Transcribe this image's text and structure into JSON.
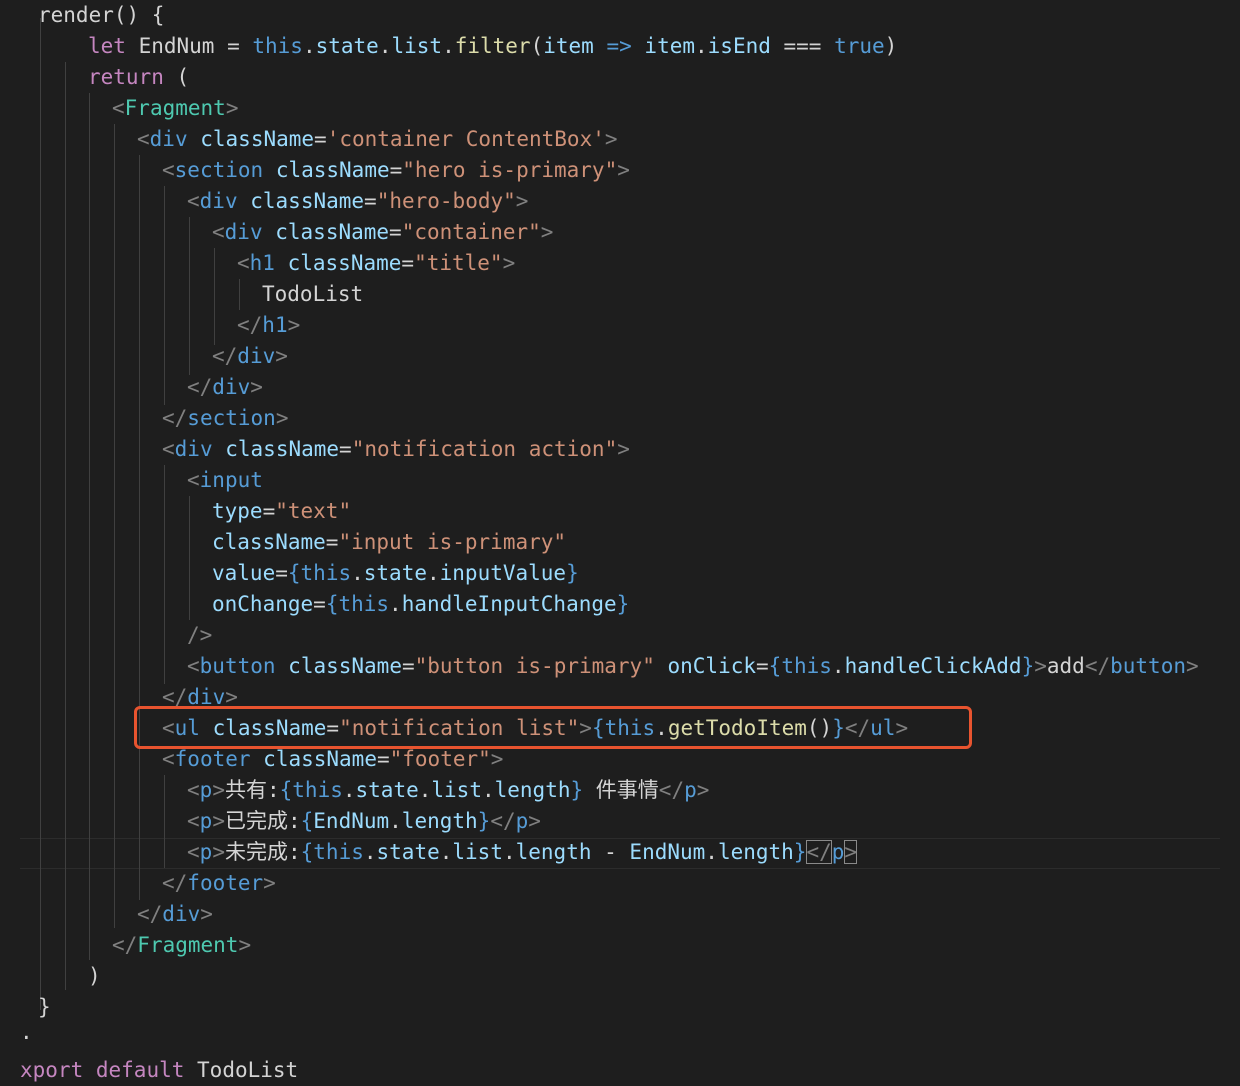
{
  "editor": {
    "theme": "dark",
    "highlight_color": "#e8542f",
    "lines": [
      [
        [
          "plain",
          "render() {"
        ]
      ],
      [
        [
          "kw",
          "let"
        ],
        [
          "plain",
          " EndNum = "
        ],
        [
          "var",
          "this"
        ],
        [
          "plain",
          "."
        ],
        [
          "prop",
          "state"
        ],
        [
          "plain",
          "."
        ],
        [
          "prop",
          "list"
        ],
        [
          "plain",
          "."
        ],
        [
          "fn",
          "filter"
        ],
        [
          "plain",
          "("
        ],
        [
          "prop",
          "item"
        ],
        [
          "plain",
          " "
        ],
        [
          "var",
          "=>"
        ],
        [
          "plain",
          " "
        ],
        [
          "prop",
          "item"
        ],
        [
          "plain",
          "."
        ],
        [
          "prop",
          "isEnd"
        ],
        [
          "plain",
          " === "
        ],
        [
          "var",
          "true"
        ],
        [
          "plain",
          ")"
        ]
      ],
      [
        [
          "kw",
          "return"
        ],
        [
          "plain",
          " ("
        ]
      ],
      [
        [
          "punct",
          "<"
        ],
        [
          "comp",
          "Fragment"
        ],
        [
          "punct",
          ">"
        ]
      ],
      [
        [
          "punct",
          "<"
        ],
        [
          "tag",
          "div"
        ],
        [
          "plain",
          " "
        ],
        [
          "attr",
          "className"
        ],
        [
          "plain",
          "="
        ],
        [
          "str",
          "'container ContentBox'"
        ],
        [
          "punct",
          ">"
        ]
      ],
      [
        [
          "punct",
          "<"
        ],
        [
          "tag",
          "section"
        ],
        [
          "plain",
          " "
        ],
        [
          "attr",
          "className"
        ],
        [
          "plain",
          "="
        ],
        [
          "str",
          "\"hero is-primary\""
        ],
        [
          "punct",
          ">"
        ]
      ],
      [
        [
          "punct",
          "<"
        ],
        [
          "tag",
          "div"
        ],
        [
          "plain",
          " "
        ],
        [
          "attr",
          "className"
        ],
        [
          "plain",
          "="
        ],
        [
          "str",
          "\"hero-body\""
        ],
        [
          "punct",
          ">"
        ]
      ],
      [
        [
          "punct",
          "<"
        ],
        [
          "tag",
          "div"
        ],
        [
          "plain",
          " "
        ],
        [
          "attr",
          "className"
        ],
        [
          "plain",
          "="
        ],
        [
          "str",
          "\"container\""
        ],
        [
          "punct",
          ">"
        ]
      ],
      [
        [
          "punct",
          "<"
        ],
        [
          "tag",
          "h1"
        ],
        [
          "plain",
          " "
        ],
        [
          "attr",
          "className"
        ],
        [
          "plain",
          "="
        ],
        [
          "str",
          "\"title\""
        ],
        [
          "punct",
          ">"
        ]
      ],
      [
        [
          "plain",
          "TodoList"
        ]
      ],
      [
        [
          "punct",
          "</"
        ],
        [
          "tag",
          "h1"
        ],
        [
          "punct",
          ">"
        ]
      ],
      [
        [
          "punct",
          "</"
        ],
        [
          "tag",
          "div"
        ],
        [
          "punct",
          ">"
        ]
      ],
      [
        [
          "punct",
          "</"
        ],
        [
          "tag",
          "div"
        ],
        [
          "punct",
          ">"
        ]
      ],
      [
        [
          "punct",
          "</"
        ],
        [
          "tag",
          "section"
        ],
        [
          "punct",
          ">"
        ]
      ],
      [
        [
          "punct",
          "<"
        ],
        [
          "tag",
          "div"
        ],
        [
          "plain",
          " "
        ],
        [
          "attr",
          "className"
        ],
        [
          "plain",
          "="
        ],
        [
          "str",
          "\"notification action\""
        ],
        [
          "punct",
          ">"
        ]
      ],
      [
        [
          "punct",
          "<"
        ],
        [
          "tag",
          "input"
        ]
      ],
      [
        [
          "attr",
          "type"
        ],
        [
          "plain",
          "="
        ],
        [
          "str",
          "\"text\""
        ]
      ],
      [
        [
          "attr",
          "className"
        ],
        [
          "plain",
          "="
        ],
        [
          "str",
          "\"input is-primary\""
        ]
      ],
      [
        [
          "attr",
          "value"
        ],
        [
          "plain",
          "="
        ],
        [
          "brace",
          "{"
        ],
        [
          "var",
          "this"
        ],
        [
          "plain",
          "."
        ],
        [
          "prop",
          "state"
        ],
        [
          "plain",
          "."
        ],
        [
          "prop",
          "inputValue"
        ],
        [
          "brace",
          "}"
        ]
      ],
      [
        [
          "attr",
          "onChange"
        ],
        [
          "plain",
          "="
        ],
        [
          "brace",
          "{"
        ],
        [
          "var",
          "this"
        ],
        [
          "plain",
          "."
        ],
        [
          "prop",
          "handleInputChange"
        ],
        [
          "brace",
          "}"
        ]
      ],
      [
        [
          "punct",
          "/>"
        ]
      ],
      [
        [
          "punct",
          "<"
        ],
        [
          "tag",
          "button"
        ],
        [
          "plain",
          " "
        ],
        [
          "attr",
          "className"
        ],
        [
          "plain",
          "="
        ],
        [
          "str",
          "\"button is-primary\""
        ],
        [
          "plain",
          " "
        ],
        [
          "attr",
          "onClick"
        ],
        [
          "plain",
          "="
        ],
        [
          "brace",
          "{"
        ],
        [
          "var",
          "this"
        ],
        [
          "plain",
          "."
        ],
        [
          "prop",
          "handleClickAdd"
        ],
        [
          "brace",
          "}"
        ],
        [
          "punct",
          ">"
        ],
        [
          "plain",
          "add"
        ],
        [
          "punct",
          "</"
        ],
        [
          "tag",
          "button"
        ],
        [
          "punct",
          ">"
        ]
      ],
      [
        [
          "punct",
          "</"
        ],
        [
          "tag",
          "div"
        ],
        [
          "punct",
          ">"
        ]
      ],
      [
        [
          "punct",
          "<"
        ],
        [
          "tag",
          "ul"
        ],
        [
          "plain",
          " "
        ],
        [
          "attr",
          "className"
        ],
        [
          "plain",
          "="
        ],
        [
          "str",
          "\"notification list\""
        ],
        [
          "punct",
          ">"
        ],
        [
          "brace",
          "{"
        ],
        [
          "var",
          "this"
        ],
        [
          "plain",
          "."
        ],
        [
          "fn",
          "getTodoItem"
        ],
        [
          "plain",
          "()"
        ],
        [
          "brace",
          "}"
        ],
        [
          "punct",
          "</"
        ],
        [
          "tag",
          "ul"
        ],
        [
          "punct",
          ">"
        ]
      ],
      [
        [
          "punct",
          "<"
        ],
        [
          "tag",
          "footer"
        ],
        [
          "plain",
          " "
        ],
        [
          "attr",
          "className"
        ],
        [
          "plain",
          "="
        ],
        [
          "str",
          "\"footer\""
        ],
        [
          "punct",
          ">"
        ]
      ],
      [
        [
          "punct",
          "<"
        ],
        [
          "tag",
          "p"
        ],
        [
          "punct",
          ">"
        ],
        [
          "plain",
          "共有:"
        ],
        [
          "brace",
          "{"
        ],
        [
          "var",
          "this"
        ],
        [
          "plain",
          "."
        ],
        [
          "prop",
          "state"
        ],
        [
          "plain",
          "."
        ],
        [
          "prop",
          "list"
        ],
        [
          "plain",
          "."
        ],
        [
          "prop",
          "length"
        ],
        [
          "brace",
          "}"
        ],
        [
          "plain",
          " 件事情"
        ],
        [
          "punct",
          "</"
        ],
        [
          "tag",
          "p"
        ],
        [
          "punct",
          ">"
        ]
      ],
      [
        [
          "punct",
          "<"
        ],
        [
          "tag",
          "p"
        ],
        [
          "punct",
          ">"
        ],
        [
          "plain",
          "已完成:"
        ],
        [
          "brace",
          "{"
        ],
        [
          "prop",
          "EndNum"
        ],
        [
          "plain",
          "."
        ],
        [
          "prop",
          "length"
        ],
        [
          "brace",
          "}"
        ],
        [
          "punct",
          "</"
        ],
        [
          "tag",
          "p"
        ],
        [
          "punct",
          ">"
        ]
      ],
      [
        [
          "punct",
          "<"
        ],
        [
          "tag",
          "p"
        ],
        [
          "punct",
          ">"
        ],
        [
          "plain",
          "未完成:"
        ],
        [
          "brace",
          "{"
        ],
        [
          "var",
          "this"
        ],
        [
          "plain",
          "."
        ],
        [
          "prop",
          "state"
        ],
        [
          "plain",
          "."
        ],
        [
          "prop",
          "list"
        ],
        [
          "plain",
          "."
        ],
        [
          "prop",
          "length"
        ],
        [
          "plain",
          " - "
        ],
        [
          "prop",
          "EndNum"
        ],
        [
          "plain",
          "."
        ],
        [
          "prop",
          "length"
        ],
        [
          "brace",
          "}"
        ],
        [
          "punct",
          "</"
        ],
        [
          "tag",
          "p"
        ],
        [
          "punct",
          ">"
        ]
      ],
      [
        [
          "punct",
          "</"
        ],
        [
          "tag",
          "footer"
        ],
        [
          "punct",
          ">"
        ]
      ],
      [
        [
          "punct",
          "</"
        ],
        [
          "tag",
          "div"
        ],
        [
          "punct",
          ">"
        ]
      ],
      [
        [
          "punct",
          "</"
        ],
        [
          "comp",
          "Fragment"
        ],
        [
          "punct",
          ">"
        ]
      ],
      [
        [
          "plain",
          ")"
        ]
      ],
      [
        [
          "plain",
          "}"
        ]
      ],
      [
        [
          "plain",
          "·"
        ]
      ],
      [
        [
          "kw",
          "xport"
        ],
        [
          "plain",
          " "
        ],
        [
          "kw",
          "default"
        ],
        [
          "plain",
          " TodoList"
        ]
      ]
    ]
  }
}
